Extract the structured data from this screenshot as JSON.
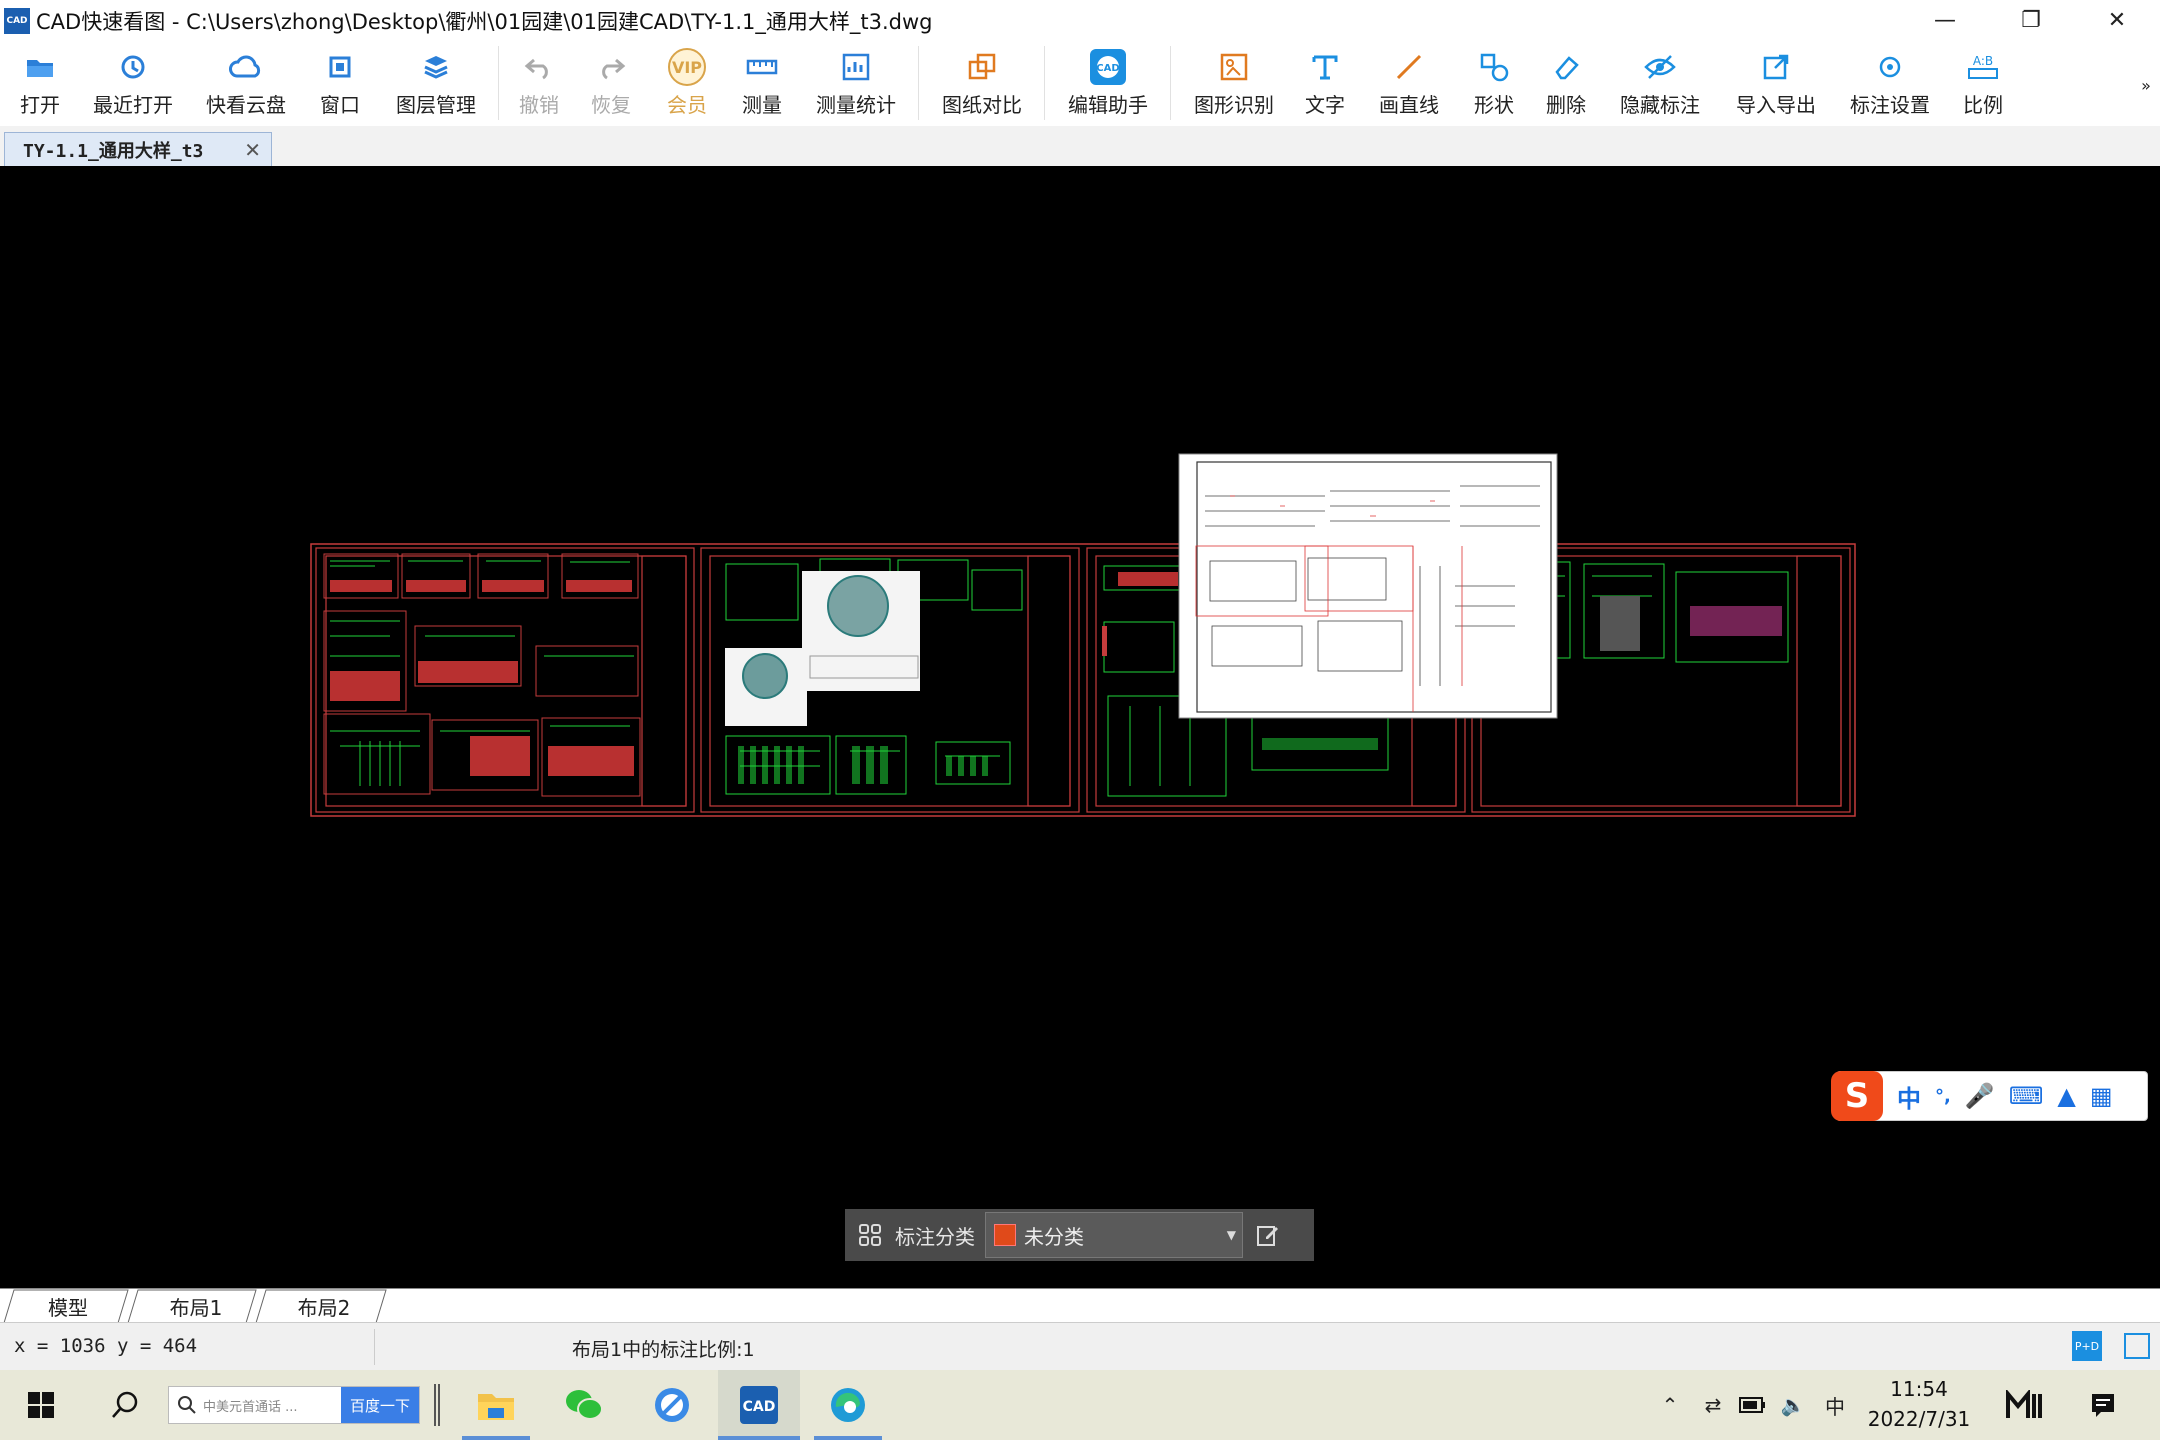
{
  "window": {
    "title": "CAD快速看图 - C:\\Users\\zhong\\Desktop\\衢州\\01园建\\01园建CAD\\TY-1.1_通用大样_t3.dwg",
    "logo_text": "CAD",
    "controls": [
      "minimize",
      "restore",
      "close"
    ]
  },
  "toolbar": {
    "items": [
      {
        "label": "打开",
        "icon": "folder-open-icon"
      },
      {
        "label": "最近打开",
        "icon": "recent-icon"
      },
      {
        "label": "快看云盘",
        "icon": "cloud-icon"
      },
      {
        "label": "窗口",
        "icon": "window-icon"
      },
      {
        "label": "图层管理",
        "icon": "layers-icon"
      },
      {
        "label": "撤销",
        "icon": "undo-icon",
        "disabled": true
      },
      {
        "label": "恢复",
        "icon": "redo-icon",
        "disabled": true
      },
      {
        "label": "会员",
        "icon": "vip-icon",
        "badge": "VIP"
      },
      {
        "label": "测量",
        "icon": "measure-icon"
      },
      {
        "label": "测量统计",
        "icon": "measure-stats-icon"
      },
      {
        "label": "图纸对比",
        "icon": "compare-icon"
      },
      {
        "label": "编辑助手",
        "icon": "edit-assistant-icon",
        "badge": "CAD"
      },
      {
        "label": "图形识别",
        "icon": "shape-recognize-icon"
      },
      {
        "label": "文字",
        "icon": "text-icon"
      },
      {
        "label": "画直线",
        "icon": "line-icon"
      },
      {
        "label": "形状",
        "icon": "shape-icon"
      },
      {
        "label": "删除",
        "icon": "eraser-icon"
      },
      {
        "label": "隐藏标注",
        "icon": "hide-eye-icon"
      },
      {
        "label": "导入导出",
        "icon": "import-export-icon"
      },
      {
        "label": "标注设置",
        "icon": "annotation-settings-icon"
      },
      {
        "label": "比例",
        "icon": "scale-icon",
        "badge": "A:B"
      }
    ],
    "overflow": "»"
  },
  "document_tab": {
    "label": "TY-1.1_通用大样_t3",
    "close": "✕"
  },
  "annotation_bar": {
    "label": "标注分类",
    "selected": "未分类",
    "swatch_color": "#e04a1a"
  },
  "ime": {
    "logo": "S",
    "mode": "中",
    "punct": "°,"
  },
  "layout_tabs": [
    "模型",
    "布局1",
    "布局2"
  ],
  "active_layout": "布局1",
  "status": {
    "coords": "x = 1036  y = 464",
    "scale_text": "布局1中的标注比例:1"
  },
  "taskbar": {
    "search_placeholder": "中美元首通话 ...",
    "search_button": "百度一下",
    "time": "11:54",
    "date": "2022/7/31",
    "tray_lang": "中"
  },
  "colors": {
    "accent": "#1b7fd6",
    "drawing_border": "#c53c3c",
    "drawing_lines": "#1fd33a"
  }
}
